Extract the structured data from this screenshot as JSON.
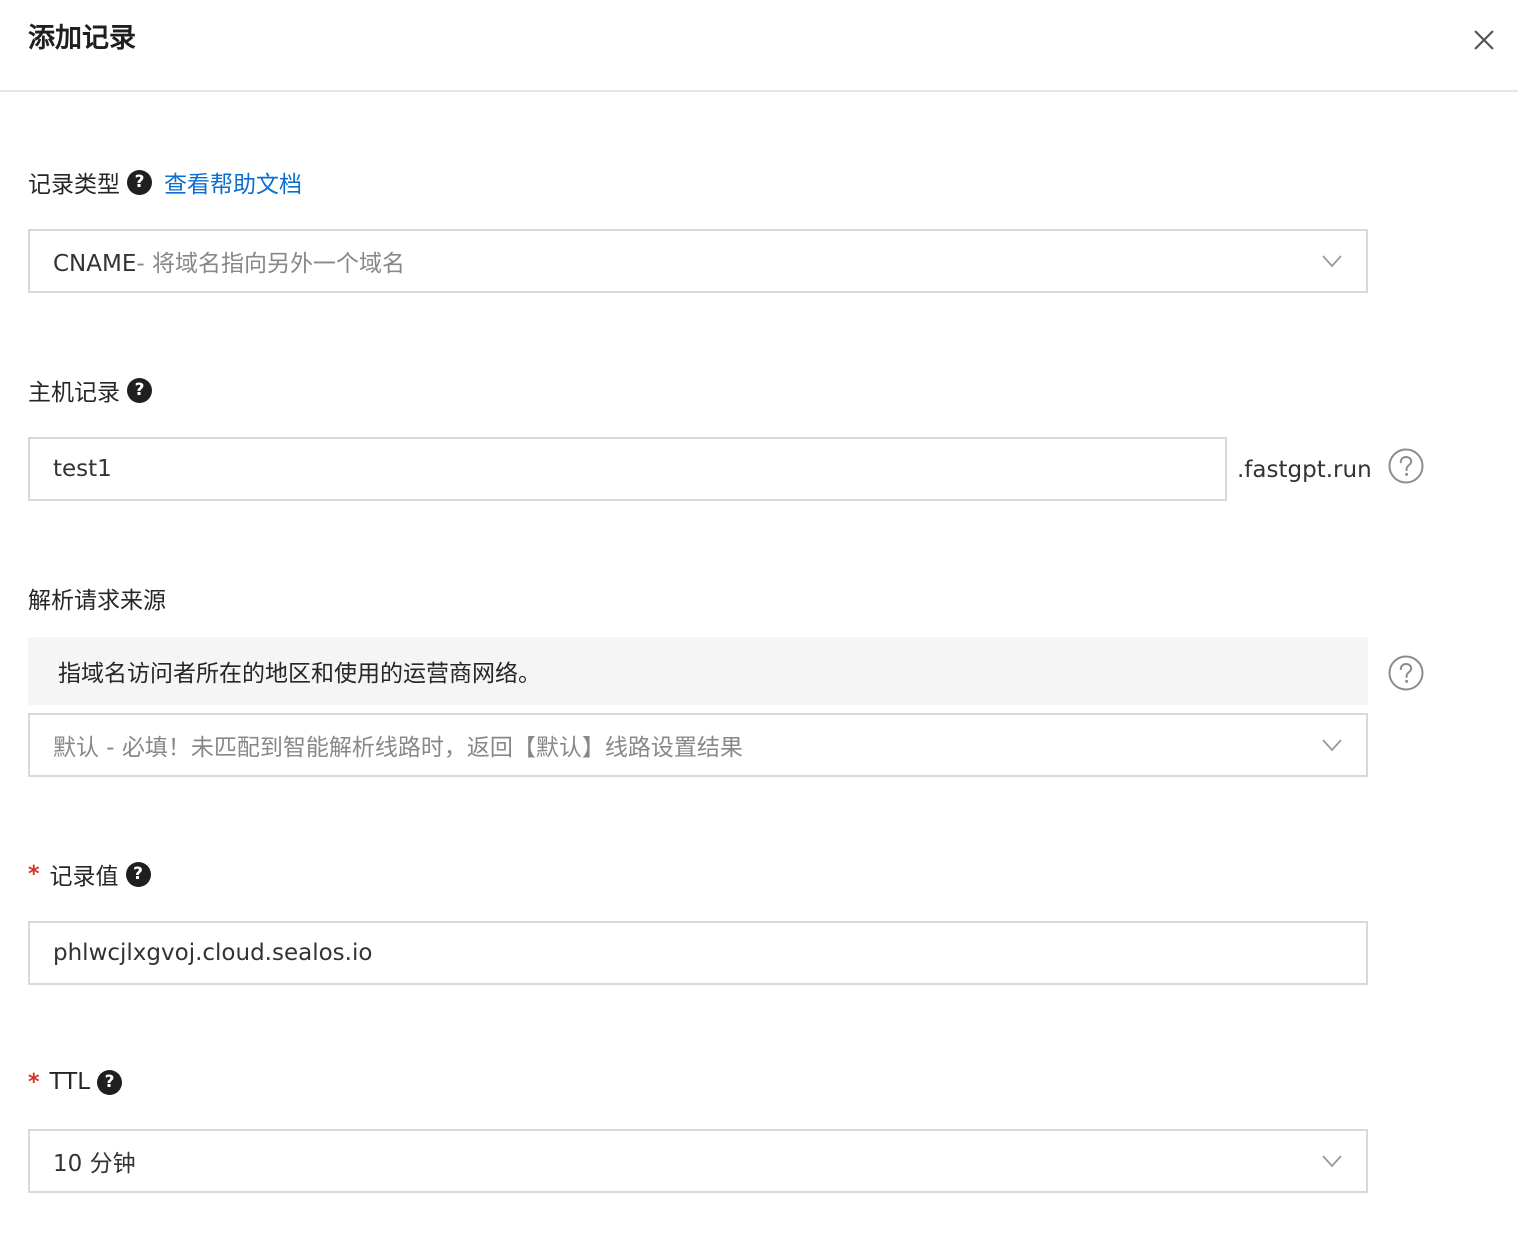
{
  "dialog": {
    "title": "添加记录"
  },
  "record_type": {
    "label": "记录类型",
    "help_link": "查看帮助文档",
    "value_prefix": "CNAME",
    "value_hint": "- 将域名指向另外一个域名"
  },
  "host_record": {
    "label": "主机记录",
    "value": "test1",
    "suffix": ".fastgpt.run"
  },
  "resolve_source": {
    "label": "解析请求来源",
    "info": "指域名访问者所在的地区和使用的运营商网络。",
    "value": "默认 - 必填！未匹配到智能解析线路时，返回【默认】线路设置结果"
  },
  "record_value": {
    "required_mark": "*",
    "label": "记录值",
    "value": "phlwcjlxgvoj.cloud.sealos.io"
  },
  "ttl": {
    "required_mark": "*",
    "label": "TTL",
    "value": "10 分钟"
  },
  "icons": {
    "help": "question-mark-icon",
    "close": "close-icon",
    "dropdown": "chevron-down-icon"
  }
}
